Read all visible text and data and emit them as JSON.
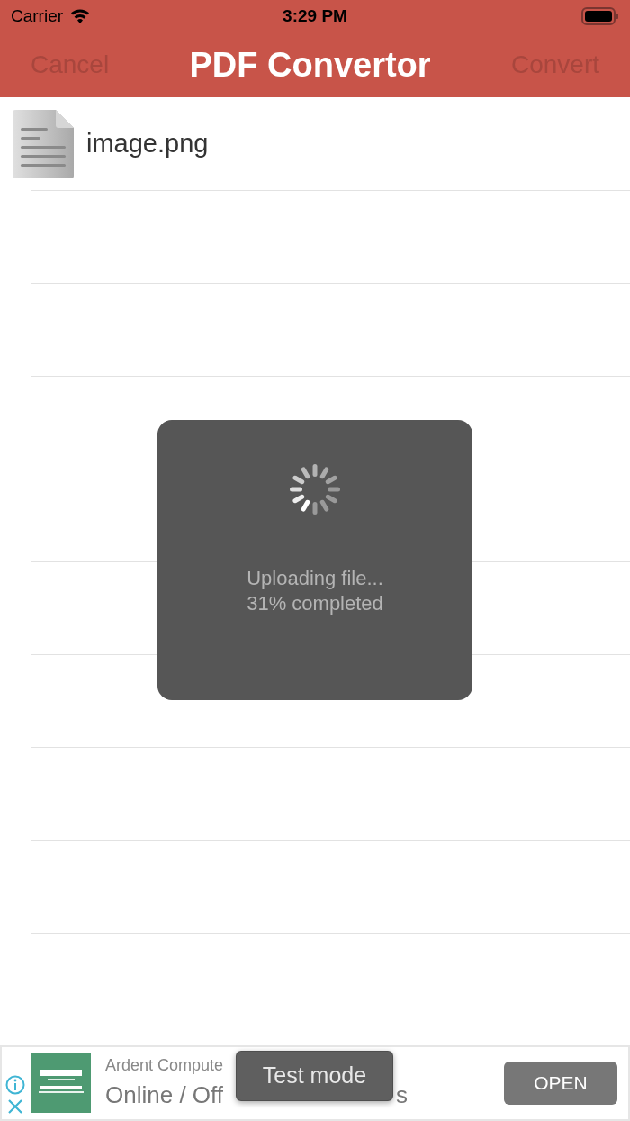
{
  "status_bar": {
    "carrier": "Carrier",
    "time": "3:29 PM"
  },
  "nav": {
    "title": "PDF Convertor",
    "left": {
      "label": "Cancel",
      "disabled": true
    },
    "right": {
      "label": "Convert",
      "disabled": true
    }
  },
  "files": [
    {
      "name": "image.png"
    }
  ],
  "hud": {
    "lines": [
      "Uploading file...",
      "31% completed"
    ]
  },
  "ad": {
    "advertiser": "Ardent Compute",
    "headline": [
      "Online / Off",
      "s"
    ],
    "button": "OPEN"
  },
  "toast": "Test mode"
}
